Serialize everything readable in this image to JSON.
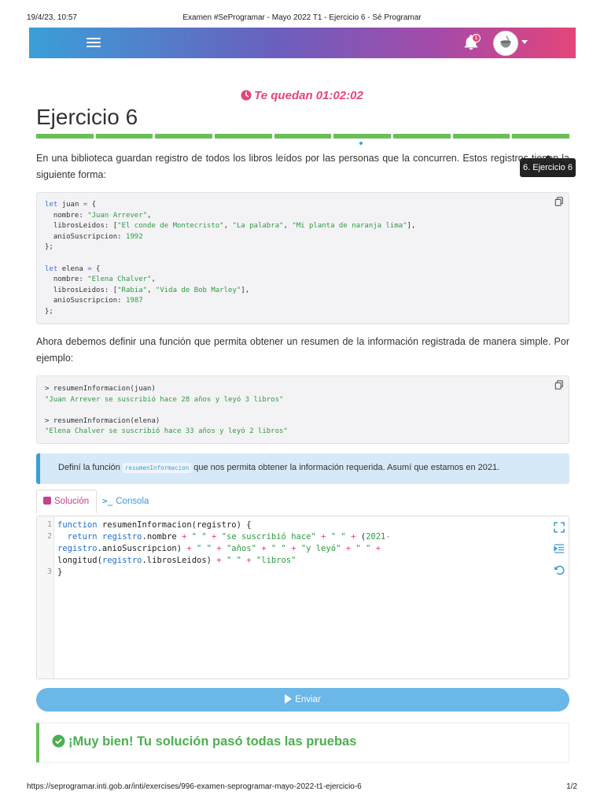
{
  "print": {
    "datetime": "19/4/23, 10:57",
    "doc_title": "Examen #SeProgramar - Mayo 2022 T1 - Ejercicio 6 - Sé Programar",
    "url": "https://seprogramar.inti.gob.ar/inti/exercises/996-examen-seprogramar-mayo-2022-t1-ejercicio-6",
    "page": "1/2"
  },
  "navbar": {
    "notification_count": "1",
    "gradient": [
      "#3a9fd8",
      "#6a5fbf",
      "#a64aa8",
      "#e4457a"
    ]
  },
  "timer": {
    "text": "Te quedan 01:02:02"
  },
  "page_title": "Ejercicio 6",
  "progress": {
    "segments": 9,
    "current": 6
  },
  "tooltip": "6. Ejercicio 6",
  "intro": "En una biblioteca guardan registro de todos los libros leídos por las personas que la concurren. Estos registros tienen la siguiente forma:",
  "code_example": {
    "juan": {
      "var_kw": "let",
      "name": "juan",
      "nombre": "\"Juan Arrever\"",
      "libros": [
        "\"El conde de Montecristo\"",
        "\"La palabra\"",
        "\"Mi planta de naranja lima\""
      ],
      "anio": "1992"
    },
    "elena": {
      "var_kw": "let",
      "name": "elena",
      "nombre": "\"Elena Chalver\"",
      "libros": [
        "\"Rabia\"",
        "\"Vida de Bob Marley\""
      ],
      "anio": "1987"
    }
  },
  "explain": "Ahora debemos definir una función que permita obtener un resumen de la información registrada de manera simple. Por ejemplo:",
  "console_example": {
    "call1": "> resumenInformacion(juan)",
    "result1": "\"Juan Arrever se suscribió hace 28 años y leyó 3 libros\"",
    "call2": "> resumenInformacion(elena)",
    "result2": "\"Elena Chalver se suscribió hace 33 años y leyó 2 libros\""
  },
  "info": {
    "before": "Definí la función ",
    "code": "resumenInformacion",
    "after": " que nos permita obtener la información requerida. Asumí que estamos en 2021."
  },
  "tabs": {
    "solucion": "Solución",
    "consola": "Consola"
  },
  "editor": {
    "line_numbers": [
      "1",
      "2",
      "3"
    ]
  },
  "send_button": "Enviar",
  "success": "¡Muy bien! Tu solución pasó todas las pruebas",
  "colors": {
    "accent": "#e4457a",
    "success": "#4caf50",
    "info": "#3a9fd8",
    "progress": "#6bbf59"
  }
}
